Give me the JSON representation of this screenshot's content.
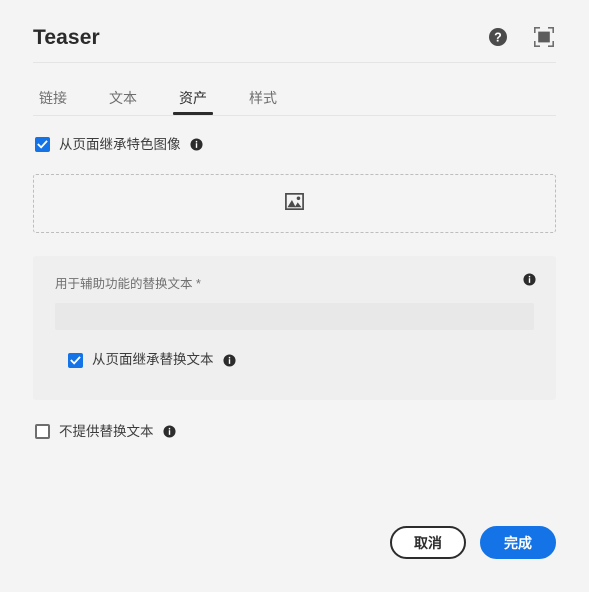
{
  "header": {
    "title": "Teaser",
    "help_icon": "help-circle-icon",
    "fullscreen_icon": "fullscreen-icon"
  },
  "tabs": [
    {
      "label": "链接",
      "active": false
    },
    {
      "label": "文本",
      "active": false
    },
    {
      "label": "资产",
      "active": true
    },
    {
      "label": "样式",
      "active": false
    }
  ],
  "assets": {
    "inherit_featured_image": {
      "label": "从页面继承特色图像",
      "checked": true,
      "info_icon": "info-icon"
    },
    "dropzone": {
      "icon": "image-placeholder-icon"
    },
    "alt_text_panel": {
      "label": "用于辅助功能的替换文本 *",
      "value": "",
      "placeholder": "",
      "info_icon": "info-icon",
      "inherit_alt_text": {
        "label": "从页面继承替换文本",
        "checked": true,
        "info_icon": "info-icon"
      }
    },
    "no_alt_text": {
      "label": "不提供替换文本",
      "checked": false,
      "info_icon": "info-icon"
    }
  },
  "footer": {
    "cancel_label": "取消",
    "done_label": "完成"
  },
  "colors": {
    "accent": "#1473E6",
    "background": "#F4F4F4",
    "panel": "#EFEFEF",
    "input": "#E8E8E8",
    "text": "#2C2C2C",
    "muted_text": "#6E6E6E"
  }
}
